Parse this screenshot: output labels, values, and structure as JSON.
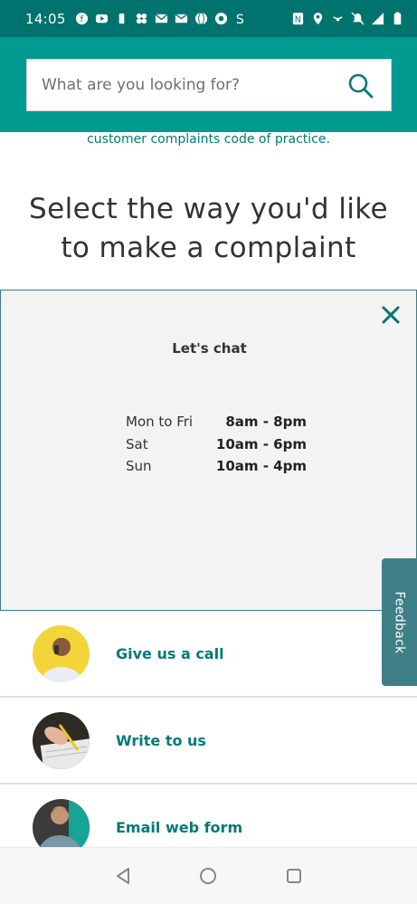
{
  "status_bar": {
    "time": "14:05"
  },
  "search": {
    "placeholder": "What are you looking for?"
  },
  "intro": {
    "code_line": "customer complaints code of practice."
  },
  "page": {
    "heading_line1": "Select the way you'd like",
    "heading_line2": "to make a complaint"
  },
  "chat": {
    "title": "Let's chat",
    "hours": [
      {
        "day": "Mon to Fri",
        "time": "8am - 8pm"
      },
      {
        "day": "Sat",
        "time": "10am - 6pm"
      },
      {
        "day": "Sun",
        "time": "10am - 4pm"
      }
    ]
  },
  "feedback": {
    "label": "Feedback"
  },
  "options": [
    {
      "label": "Give us a call",
      "icon": "person-on-phone-avatar"
    },
    {
      "label": "Write to us",
      "icon": "hand-writing-avatar"
    },
    {
      "label": "Email web form",
      "icon": "person-at-laptop-avatar"
    }
  ],
  "colors": {
    "status_bar": "#00736e",
    "header": "#009a91",
    "accent_text": "#007a77",
    "feedback_tab": "#3f7f87",
    "panel_bg": "#f3f3f3"
  }
}
